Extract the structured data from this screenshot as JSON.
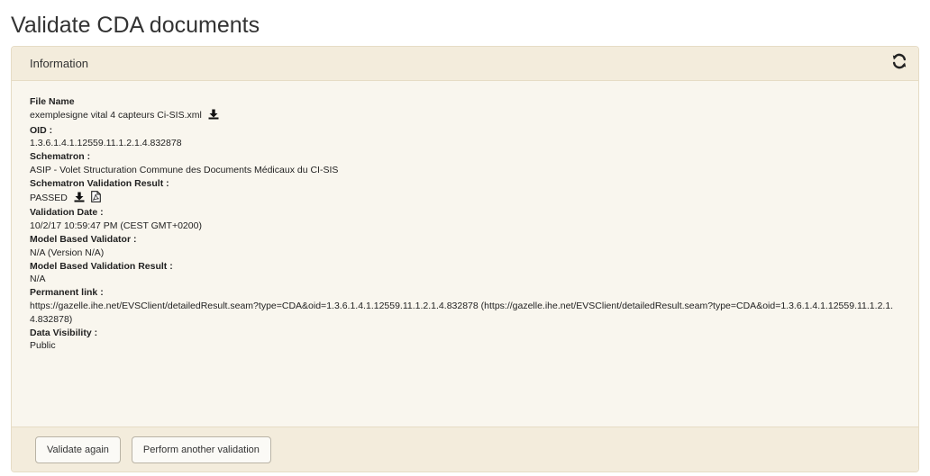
{
  "page": {
    "title": "Validate CDA documents"
  },
  "panel": {
    "heading": "Information",
    "refresh_icon": "refresh-icon"
  },
  "fields": {
    "file_name_label": "File Name",
    "file_name_value": "exemplesigne vital 4 capteurs  Ci-SIS.xml",
    "oid_label": "OID :",
    "oid_value": "1.3.6.1.4.1.12559.11.1.2.1.4.832878",
    "schematron_label": "Schematron :",
    "schematron_value": "ASIP - Volet Structuration Commune des Documents Médicaux du CI-SIS",
    "schematron_result_label": "Schematron Validation Result :",
    "schematron_result_value": "PASSED",
    "validation_date_label": "Validation Date :",
    "validation_date_value": "10/2/17 10:59:47 PM (CEST GMT+0200)",
    "model_validator_label": "Model Based Validator :",
    "model_validator_value": "N/A (Version N/A)",
    "model_result_label": "Model Based Validation Result :",
    "model_result_value": "N/A",
    "permanent_link_label": "Permanent link :",
    "permanent_link_value": "https://gazelle.ihe.net/EVSClient/detailedResult.seam?type=CDA&oid=1.3.6.1.4.1.12559.11.1.2.1.4.832878 (https://gazelle.ihe.net/EVSClient/detailedResult.seam?type=CDA&oid=1.3.6.1.4.1.12559.11.1.2.1.4.832878)",
    "data_visibility_label": "Data Visibility :",
    "data_visibility_value": "Public"
  },
  "footer": {
    "validate_again_label": "Validate again",
    "perform_another_label": "Perform another validation"
  }
}
